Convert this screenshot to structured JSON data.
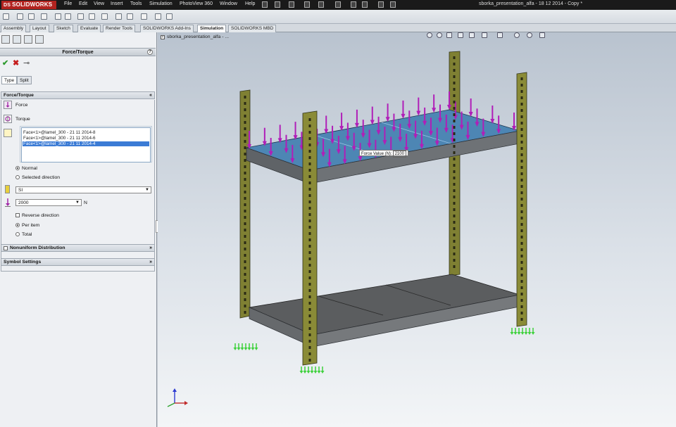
{
  "app": {
    "logo": "SOLIDWORKS",
    "window_title": "sborka_presentation_alfa - 18 12 2014 - Copy *",
    "menu": [
      "File",
      "Edit",
      "View",
      "Insert",
      "Tools",
      "Simulation",
      "PhotoView 360",
      "Window",
      "Help"
    ]
  },
  "tabs": [
    "Assembly",
    "Layout",
    "Sketch",
    "Evaluate",
    "Render Tools",
    "SOLIDWORKS Add-Ins",
    "Simulation",
    "SOLIDWORKS MBD"
  ],
  "active_tab": "Simulation",
  "property_manager": {
    "title": "Force/Torque",
    "help": "?",
    "ok_icon": "✔",
    "cancel_icon": "✖",
    "pin_icon": "⊸",
    "subtabs": [
      "Type",
      "Split"
    ],
    "group_title": "Force/Torque",
    "force_label": "Force",
    "torque_label": "Torque",
    "faces": [
      "Face<1>@lamel_300 - 21 11 2014-8",
      "Face<1>@lamel_300 - 21 11 2014-6",
      "Face<1>@lamel_300 - 21 11 2014-4"
    ],
    "selected_face_index": 2,
    "direction": {
      "normal": "Normal",
      "selected": "Selected direction",
      "value": "Normal"
    },
    "unit_system": "SI",
    "force_value": "2000",
    "force_unit": "N",
    "reverse_direction": "Reverse direction",
    "per_item": "Per item",
    "total": "Total",
    "distribution_mode": "Per item",
    "nonuniform_title": "Nonuniform Distribution",
    "symbol_settings_title": "Symbol Settings"
  },
  "viewport": {
    "tree_root": "sborka_presentation_alfa - ...",
    "tooltip_label": "Force Value (N):",
    "tooltip_value": "2100"
  },
  "colors": {
    "force_arrows": "#b01fb8",
    "fixtures": "#3ed13c",
    "posts": "#8a8a3a",
    "shelf": "#555555",
    "shelf_selected": "#3a93c8",
    "logo_red": "#b3231f"
  }
}
